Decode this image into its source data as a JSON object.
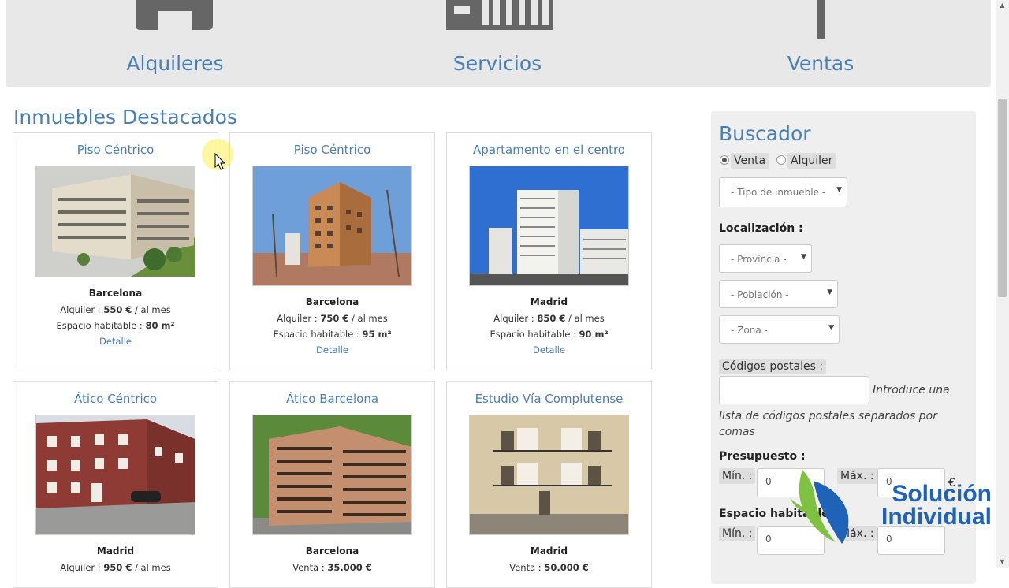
{
  "nav": [
    {
      "label": "Alquileres",
      "icon": "house-icon"
    },
    {
      "label": "Servicios",
      "icon": "building-icon"
    },
    {
      "label": "Ventas",
      "icon": "sign-icon"
    }
  ],
  "featured": {
    "title": "Inmuebles Destacados",
    "cards": [
      {
        "title": "Piso Céntrico",
        "city": "Barcelona",
        "price_label": "Alquiler :",
        "price": "550 €",
        "price_suffix": "/ al mes",
        "area_label": "Espacio habitable :",
        "area": "80 m²",
        "link": "Detalle"
      },
      {
        "title": "Piso Céntrico",
        "city": "Barcelona",
        "price_label": "Alquiler :",
        "price": "750 €",
        "price_suffix": "/ al mes",
        "area_label": "Espacio habitable :",
        "area": "95 m²",
        "link": "Detalle"
      },
      {
        "title": "Apartamento en el centro",
        "city": "Madrid",
        "price_label": "Alquiler :",
        "price": "850 €",
        "price_suffix": "/ al mes",
        "area_label": "Espacio habitable :",
        "area": "90 m²",
        "link": "Detalle"
      },
      {
        "title": "Ático Céntrico",
        "city": "Madrid",
        "price_label": "Alquiler :",
        "price": "950 €",
        "price_suffix": "/ al mes"
      },
      {
        "title": "Ático Barcelona",
        "city": "Barcelona",
        "price_label": "Venta :",
        "price": "35.000 €"
      },
      {
        "title": "Estudio Vía Complutense",
        "city": "Madrid",
        "price_label": "Venta :",
        "price": "50.000 €"
      }
    ]
  },
  "search": {
    "title": "Buscador",
    "radio_sale": "Venta",
    "radio_rent": "Alquiler",
    "type_select": "- Tipo de inmueble -",
    "location_label": "Localización :",
    "province_select": "- Provincia -",
    "town_select": "- Población -",
    "zone_select": "- Zona -",
    "postal_label": "Códigos postales :",
    "postal_hint_1": "Introduce una",
    "postal_hint_2": "lista de códigos postales separados por",
    "postal_hint_3": "comas",
    "budget_label": "Presupuesto :",
    "min_label": "Mín. :",
    "max_label": "Máx. :",
    "budget_min": "0",
    "budget_max": "0",
    "currency": "€",
    "space_label": "Espacio habitable :",
    "space_min": "0",
    "space_max": "0"
  },
  "watermark": {
    "line1": "Solución",
    "line2": "Individual"
  },
  "colors": {
    "accent": "#4a7fb5",
    "logo_blue": "#1e63b8",
    "logo_green": "#7fc241"
  }
}
